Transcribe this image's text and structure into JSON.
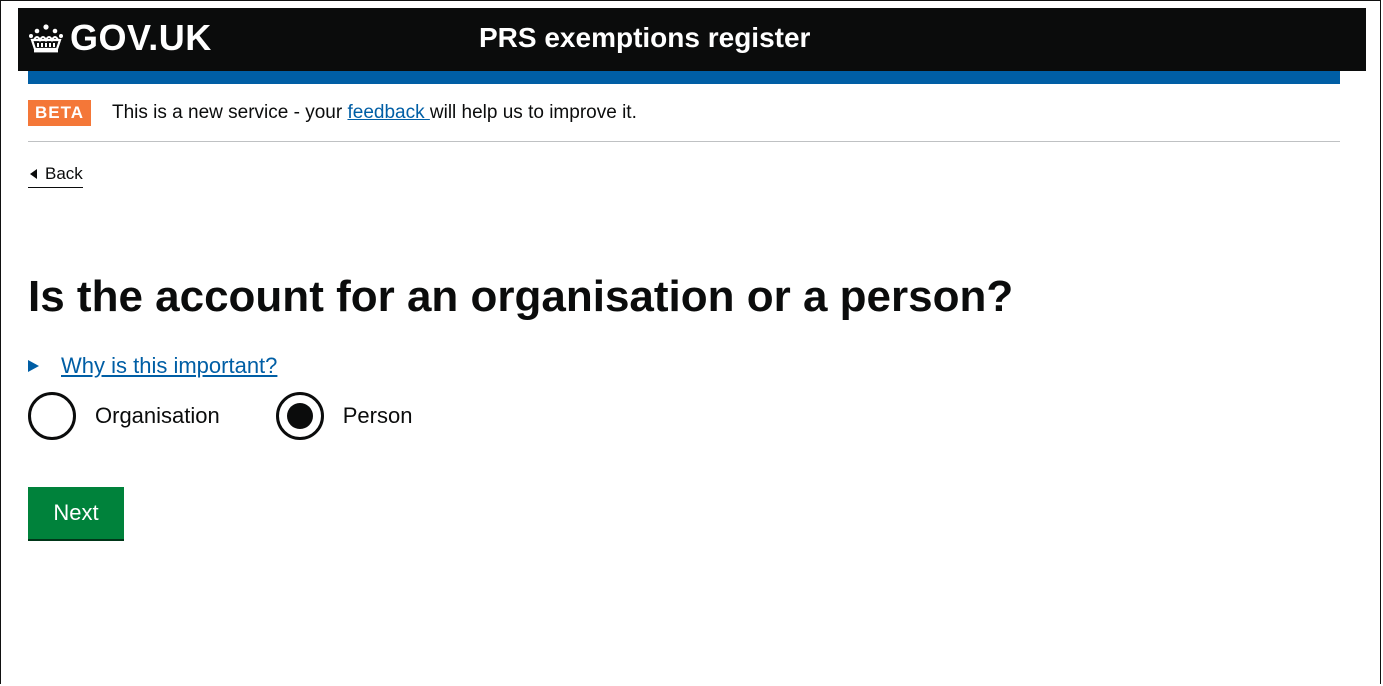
{
  "header": {
    "logo_text": "GOV.UK",
    "service_name": "PRS exemptions register"
  },
  "beta": {
    "tag": "BETA",
    "text_before": "This is a new service - your ",
    "link_text": "feedback ",
    "text_after": "will help us to improve it."
  },
  "back": {
    "label": "Back"
  },
  "question": {
    "heading": "Is the account for an organisation or a person?",
    "details_summary": "Why is this important?"
  },
  "options": [
    {
      "label": "Organisation",
      "selected": false
    },
    {
      "label": "Person",
      "selected": true
    }
  ],
  "actions": {
    "next_label": "Next"
  },
  "colors": {
    "header_bg": "#0b0c0c",
    "brand_blue": "#005ea5",
    "beta_orange": "#f47738",
    "button_green": "#00823b",
    "link_blue": "#005ea5"
  }
}
